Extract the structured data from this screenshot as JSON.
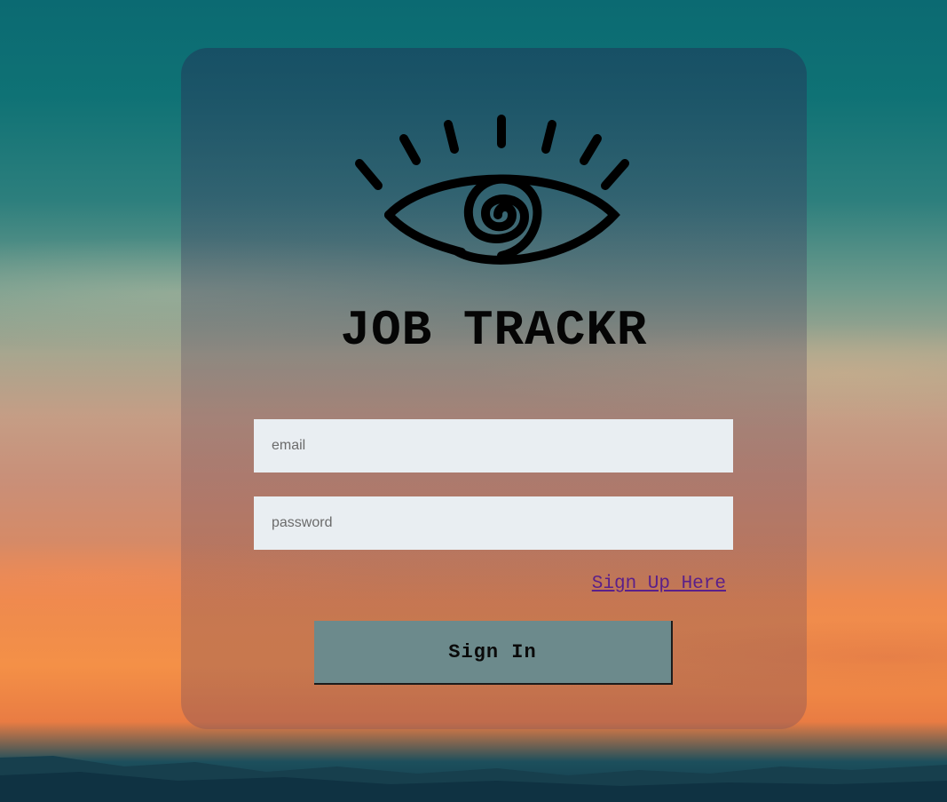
{
  "app": {
    "title": "JOB TRACKR"
  },
  "logo": {
    "icon": "eye-icon",
    "color": "#000000"
  },
  "form": {
    "email": {
      "placeholder": "email",
      "value": ""
    },
    "password": {
      "placeholder": "password",
      "value": ""
    },
    "signup_link": "Sign Up Here",
    "signin_button": "Sign In"
  },
  "colors": {
    "input_bg": "#e9eef2",
    "button_bg": "#6c8a8c",
    "link": "#5a1f8a"
  }
}
